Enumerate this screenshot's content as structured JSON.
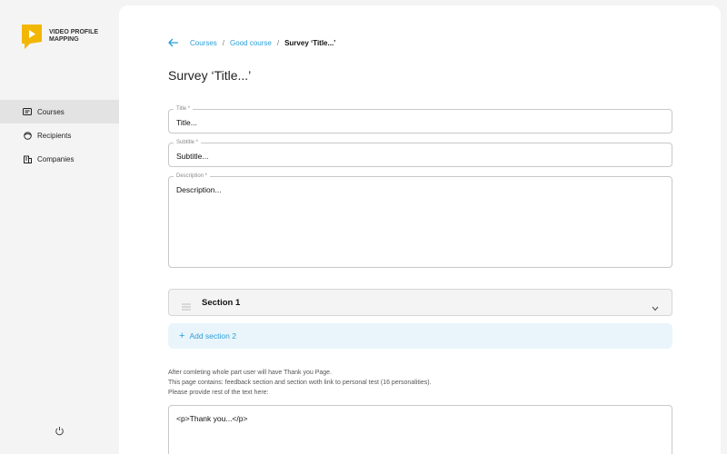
{
  "brand": {
    "name": "VIDEO PROFILE MAPPING",
    "accent": "#f2b705"
  },
  "sidebar": {
    "items": [
      {
        "label": "Courses",
        "icon": "list-icon",
        "active": true
      },
      {
        "label": "Recipients",
        "icon": "user-icon",
        "active": false
      },
      {
        "label": "Companies",
        "icon": "building-icon",
        "active": false
      }
    ],
    "power_icon": "power-icon"
  },
  "breadcrumb": {
    "items": [
      "Courses",
      "Good course"
    ],
    "separator": "/",
    "current": "Survey ‘Title...’"
  },
  "page_title": "Survey ‘Title...’",
  "form": {
    "title": {
      "label": "Title *",
      "value": "Title..."
    },
    "subtitle": {
      "label": "Subtitle *",
      "value": "Subtitle..."
    },
    "description": {
      "label": "Description *",
      "value": "Description..."
    }
  },
  "sections": [
    {
      "label": "Section 1"
    }
  ],
  "add_section_label": "Add section 2",
  "info_lines": [
    "After comleting whole part user will have Thank you Page.",
    "This page contains: feedback section and section woth link to personal test (16 personalities).",
    "Please provide rest of the text here:"
  ],
  "thank_you_text": "<p>Thank you...</p>",
  "colors": {
    "link": "#2a9fd8",
    "add_bg": "#eaf5fb",
    "active_nav": "#e3e3e3"
  }
}
